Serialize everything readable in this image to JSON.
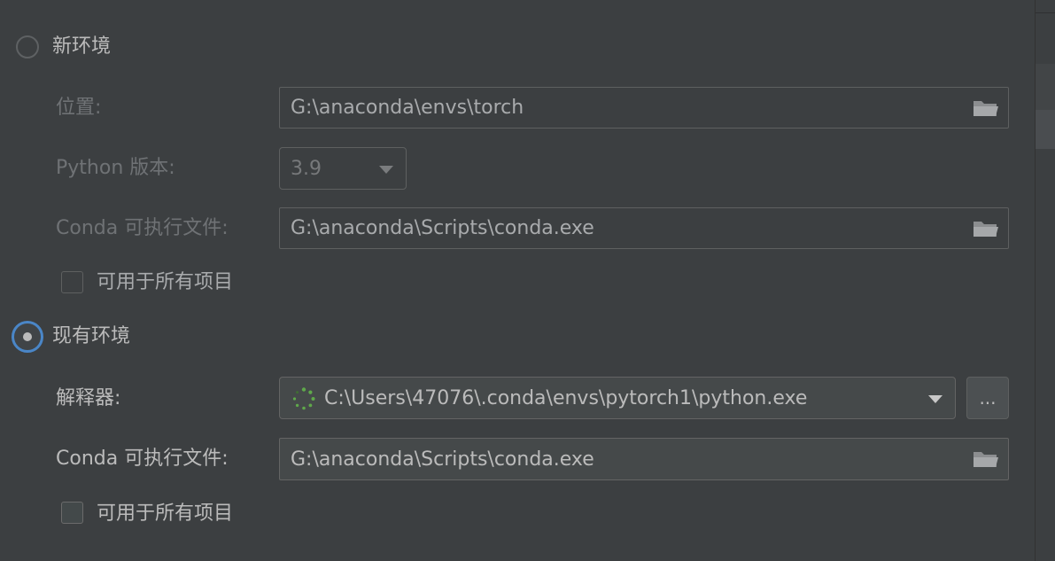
{
  "new_env": {
    "radio_label": "新环境",
    "location_label": "位置:",
    "location_value": "G:\\anaconda\\envs\\torch",
    "python_version_label": "Python 版本:",
    "python_version_value": "3.9",
    "conda_exe_label": "Conda 可执行文件:",
    "conda_exe_value": "G:\\anaconda\\Scripts\\conda.exe",
    "all_projects_label": "可用于所有项目"
  },
  "existing_env": {
    "radio_label": "现有环境",
    "interpreter_label": "解释器:",
    "interpreter_value": "C:\\Users\\47076\\.conda\\envs\\pytorch1\\python.exe",
    "browse_label": "...",
    "conda_exe_label": "Conda 可执行文件:",
    "conda_exe_value": "G:\\anaconda\\Scripts\\conda.exe",
    "all_projects_label": "可用于所有项目"
  },
  "icons": {
    "folder": "folder-icon",
    "loading": "loading-spinner-icon",
    "dropdown": "chevron-down-icon"
  },
  "colors": {
    "background": "#3c3f41",
    "accent": "#4a86c7",
    "spinner": "#5fa84a"
  }
}
